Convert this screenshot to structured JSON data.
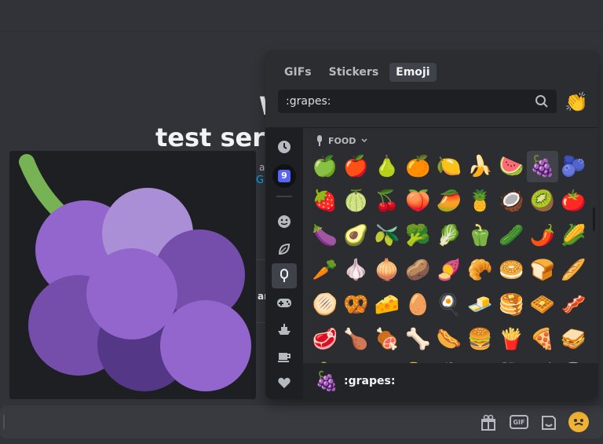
{
  "welcome": {
    "line1": "Welcome",
    "line2": "test serv",
    "sub": "ar",
    "link": "G",
    "bold": "ar"
  },
  "picker": {
    "tabs": [
      {
        "label": "GIFs",
        "active": false
      },
      {
        "label": "Stickers",
        "active": false
      },
      {
        "label": "Emoji",
        "active": true
      }
    ],
    "search_value": ":grapes:",
    "skin_tone_emoji": "👏",
    "category_label": "FOOD",
    "sidebar_icons": [
      "clock-icon",
      "server-icon",
      "smile-icon",
      "leaf-icon",
      "popsicle-icon",
      "gamepad-icon",
      "ship-icon",
      "coffee-icon",
      "heart-icon"
    ],
    "emoji_rows": [
      [
        "🍏",
        "🍎",
        "🍐",
        "🍊",
        "🍋",
        "🍌",
        "🍉",
        "🍇",
        "🫐"
      ],
      [
        "🍓",
        "🍈",
        "🍒",
        "🍑",
        "🥭",
        "🍍",
        "🥥",
        "🥝",
        "🍅"
      ],
      [
        "🍆",
        "🥑",
        "🫒",
        "🥦",
        "🥬",
        "🫑",
        "🥒",
        "🌶️",
        "🌽"
      ],
      [
        "🥕",
        "🧄",
        "🧅",
        "🥔",
        "🍠",
        "🥐",
        "🥯",
        "🍞",
        "🥖"
      ],
      [
        "🫓",
        "🥨",
        "🧀",
        "🥚",
        "🍳",
        "🧈",
        "🥞",
        "🧇",
        "🥓"
      ],
      [
        "🥩",
        "🍗",
        "🍖",
        "🦴",
        "🌭",
        "🍔",
        "🍟",
        "🍕",
        "🥪"
      ],
      [
        "🥙",
        "🧆",
        "🌮",
        "🌯",
        "🫔",
        "🥗",
        "🥘",
        "🫕",
        "🥫"
      ]
    ],
    "selected_emoji": "🍇",
    "footer_emoji": "🍇",
    "footer_name": ":grapes:"
  },
  "chat_bar": {
    "gif_label": "GIF",
    "icons": [
      "gift-icon",
      "gif-icon",
      "sticker-icon",
      "emoji-icon"
    ]
  },
  "colors": {
    "grape_light": "#AA8ED6",
    "grape_mid": "#9266CC",
    "grape_dark": "#744EAA",
    "stem": "#77B255",
    "accent": "#5865F2"
  }
}
